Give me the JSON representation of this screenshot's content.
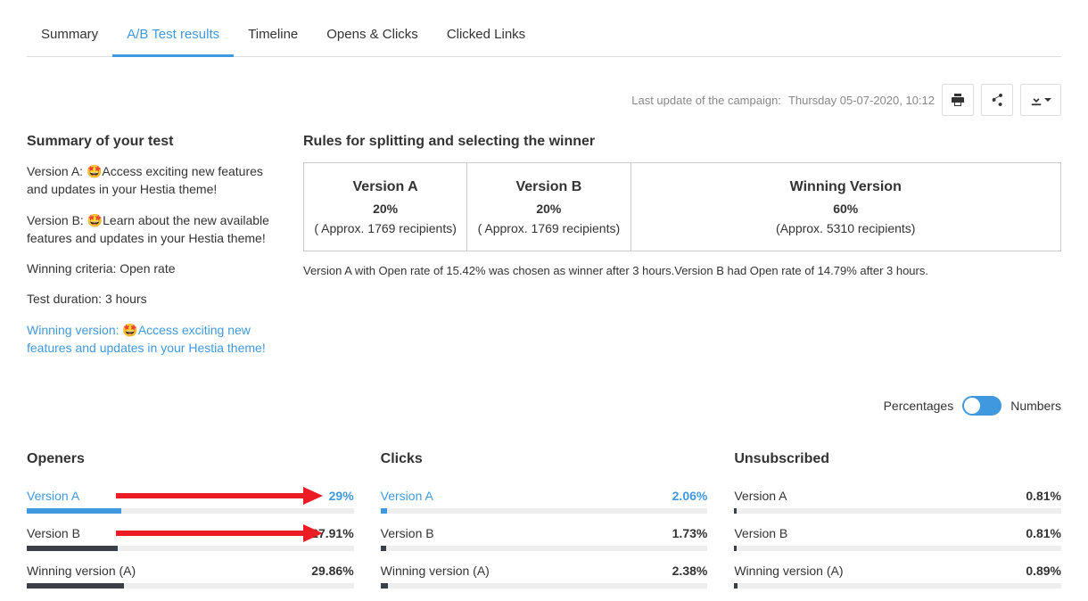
{
  "tabs": {
    "items": [
      "Summary",
      "A/B Test results",
      "Timeline",
      "Opens & Clicks",
      "Clicked Links"
    ],
    "active": 1
  },
  "toolbar": {
    "last_update_label": "Last update of the campaign:",
    "last_update_value": "Thursday 05-07-2020, 10:12"
  },
  "summary": {
    "heading": "Summary of your test",
    "version_a_prefix": "Version A: ",
    "version_a_subject": "Access exciting new features and updates in your Hestia theme!",
    "version_b_prefix": "Version B: ",
    "version_b_subject": "Learn about the new available features and updates in your Hestia theme!",
    "criteria": "Winning criteria: Open rate",
    "duration": "Test duration: 3 hours",
    "winning_prefix": "Winning version: ",
    "winning_subject": "Access exciting new features and updates in your Hestia theme!",
    "emoji": "🤩"
  },
  "rules": {
    "heading": "Rules for splitting and selecting the winner",
    "cells": [
      {
        "title": "Version A",
        "pct": "20%",
        "approx": "( Approx. 1769 recipients)"
      },
      {
        "title": "Version B",
        "pct": "20%",
        "approx": "( Approx. 1769 recipients)"
      },
      {
        "title": "Winning Version",
        "pct": "60%",
        "approx": "(Approx. 5310 recipients)"
      }
    ],
    "note": "Version A with Open rate of 15.42% was chosen as winner after 3 hours.Version B had Open rate of 14.79% after 3 hours."
  },
  "toggle": {
    "left": "Percentages",
    "right": "Numbers"
  },
  "chart_data": [
    {
      "type": "bar",
      "title": "Openers",
      "categories": [
        "Version A",
        "Version B",
        "Winning version (A)"
      ],
      "values": [
        29,
        27.91,
        29.86
      ],
      "display": [
        "29%",
        "27.91%",
        "29.86%"
      ],
      "highlight": [
        true,
        false,
        false
      ],
      "arrow": [
        true,
        true,
        false
      ]
    },
    {
      "type": "bar",
      "title": "Clicks",
      "categories": [
        "Version A",
        "Version B",
        "Winning version (A)"
      ],
      "values": [
        2.06,
        1.73,
        2.38
      ],
      "display": [
        "2.06%",
        "1.73%",
        "2.38%"
      ],
      "highlight": [
        true,
        false,
        false
      ],
      "arrow": [
        false,
        false,
        false
      ]
    },
    {
      "type": "bar",
      "title": "Unsubscribed",
      "categories": [
        "Version A",
        "Version B",
        "Winning version (A)"
      ],
      "values": [
        0.81,
        0.81,
        0.89
      ],
      "display": [
        "0.81%",
        "0.81%",
        "0.89%"
      ],
      "highlight": [
        false,
        false,
        false
      ],
      "arrow": [
        false,
        false,
        false
      ]
    }
  ]
}
